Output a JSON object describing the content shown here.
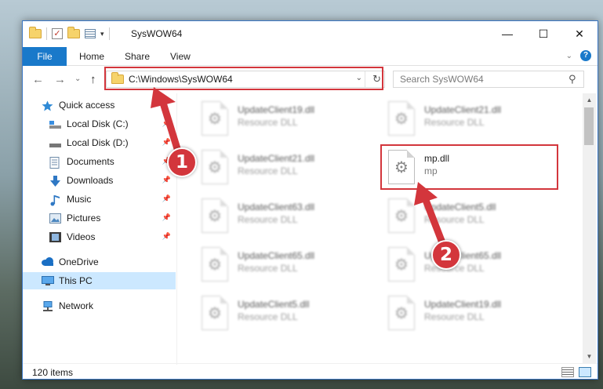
{
  "window": {
    "title": "SysWOW64",
    "controls": {
      "minimize": "—",
      "maximize": "☐",
      "close": "✕"
    }
  },
  "ribbon": {
    "tabs": [
      "File",
      "Home",
      "Share",
      "View"
    ],
    "help": "?"
  },
  "nav": {
    "back": "←",
    "forward": "→",
    "recent": "⌄",
    "up": "↑"
  },
  "address": {
    "path": "C:\\Windows\\SysWOW64"
  },
  "search": {
    "placeholder": "Search SysWOW64"
  },
  "sidebar": {
    "items": [
      {
        "label": "Quick access",
        "icon": "star-icon",
        "pinned": false
      },
      {
        "label": "Local Disk (C:)",
        "icon": "drive-icon",
        "pinned": true
      },
      {
        "label": "Local Disk (D:)",
        "icon": "drive-icon",
        "pinned": true
      },
      {
        "label": "Documents",
        "icon": "documents-icon",
        "pinned": true
      },
      {
        "label": "Downloads",
        "icon": "download-icon",
        "pinned": true
      },
      {
        "label": "Music",
        "icon": "music-icon",
        "pinned": true
      },
      {
        "label": "Pictures",
        "icon": "pictures-icon",
        "pinned": true
      },
      {
        "label": "Videos",
        "icon": "videos-icon",
        "pinned": true
      },
      {
        "label": "OneDrive",
        "icon": "cloud-icon",
        "pinned": false
      },
      {
        "label": "This PC",
        "icon": "computer-icon",
        "pinned": false,
        "selected": true
      },
      {
        "label": "Network",
        "icon": "network-icon",
        "pinned": false
      }
    ]
  },
  "files": [
    {
      "name": "UpdateClient19.dll",
      "desc": "Resource DLL"
    },
    {
      "name": "UpdateClient21.dll",
      "desc": "Resource DLL"
    },
    {
      "name": "UpdateClient21.dll",
      "desc": "Resource DLL"
    },
    {
      "name": "mp.dll",
      "desc": "mp"
    },
    {
      "name": "UpdateClient63.dll",
      "desc": "Resource DLL"
    },
    {
      "name": "UpdateClient5.dll",
      "desc": "Resource DLL"
    },
    {
      "name": "UpdateClient65.dll",
      "desc": "Resource DLL"
    },
    {
      "name": "UpdateClient65.dll",
      "desc": "Resource DLL"
    },
    {
      "name": "UpdateClient5.dll",
      "desc": "Resource DLL"
    },
    {
      "name": "UpdateClient19.dll",
      "desc": "Resource DLL"
    }
  ],
  "status": {
    "item_count": "120 items"
  },
  "callouts": [
    {
      "number": "1"
    },
    {
      "number": "2"
    }
  ],
  "colors": {
    "accent": "#1979ca",
    "callout": "#d3363c",
    "selection": "#cce8ff"
  }
}
